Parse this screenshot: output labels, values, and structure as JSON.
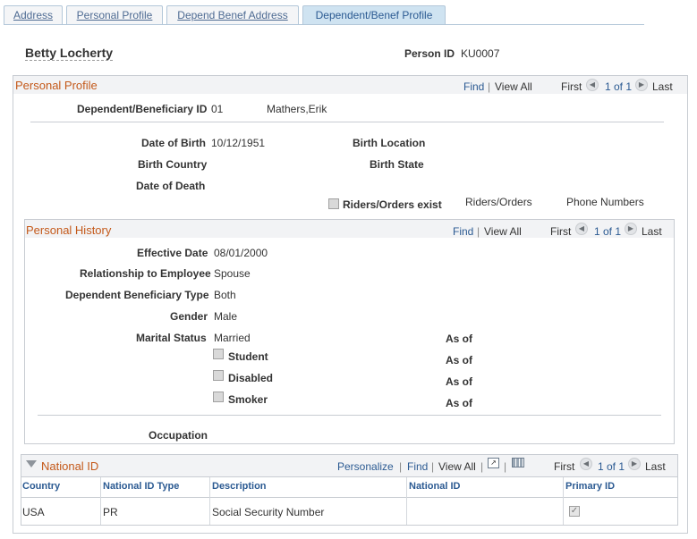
{
  "tabs": [
    "Address",
    "Personal Profile",
    "Depend Benef Address",
    "Dependent/Benef Profile"
  ],
  "header": {
    "employee_name": "Betty Locherty",
    "person_id_label": "Person ID",
    "person_id": "KU0007"
  },
  "personal_profile": {
    "title": "Personal Profile",
    "nav": {
      "find": "Find",
      "view_all": "View All",
      "first": "First",
      "range": "1 of 1",
      "last": "Last"
    },
    "dep_id_label": "Dependent/Beneficiary ID",
    "dep_id": "01",
    "dep_name": "Mathers,Erik",
    "dob_label": "Date of Birth",
    "dob": "10/12/1951",
    "birth_location_label": "Birth Location",
    "birth_country_label": "Birth Country",
    "birth_state_label": "Birth State",
    "date_of_death_label": "Date of Death",
    "riders_exist_label": "Riders/Orders exist",
    "riders_orders_link": "Riders/Orders",
    "phone_numbers_link": "Phone Numbers"
  },
  "personal_history": {
    "title": "Personal History",
    "nav": {
      "find": "Find",
      "view_all": "View All",
      "first": "First",
      "range": "1 of 1",
      "last": "Last"
    },
    "effective_date_label": "Effective Date",
    "effective_date": "08/01/2000",
    "relationship_label": "Relationship to Employee",
    "relationship": "Spouse",
    "dep_ben_type_label": "Dependent Beneficiary Type",
    "dep_ben_type": "Both",
    "gender_label": "Gender",
    "gender": "Male",
    "marital_status_label": "Marital Status",
    "marital_status": "Married",
    "student_label": "Student",
    "disabled_label": "Disabled",
    "smoker_label": "Smoker",
    "as_of_label": "As of",
    "occupation_label": "Occupation"
  },
  "national_id": {
    "title": "National ID",
    "nav": {
      "personalize": "Personalize",
      "find": "Find",
      "view_all": "View All",
      "first": "First",
      "range": "1 of 1",
      "last": "Last"
    },
    "columns": [
      "Country",
      "National ID Type",
      "Description",
      "National ID",
      "Primary ID"
    ],
    "rows": [
      {
        "country": "USA",
        "type": "PR",
        "description": "Social Security Number",
        "national_id": ""
      }
    ]
  }
}
